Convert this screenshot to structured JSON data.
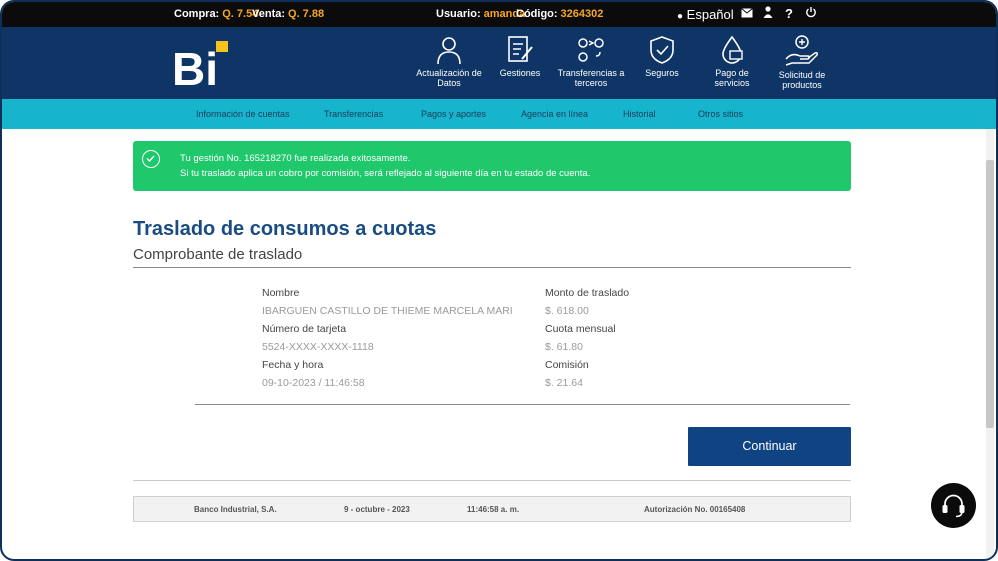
{
  "topbar": {
    "compra_label": "Compra:",
    "compra_value": "Q. 7.54",
    "venta_label": "Venta:",
    "venta_value": "Q. 7.88",
    "usuario_label": "Usuario:",
    "usuario_value": "amanda",
    "codigo_label": "Código:",
    "codigo_value": "3264302",
    "language": "Español"
  },
  "logo": "Bi",
  "nav": [
    {
      "label1": "Actualización de",
      "label2": "Datos",
      "icon": "user-icon"
    },
    {
      "label1": "Gestiones",
      "label2": "",
      "icon": "document-edit-icon"
    },
    {
      "label1": "Transferencias a",
      "label2": "terceros",
      "icon": "transfer-icon"
    },
    {
      "label1": "Seguros",
      "label2": "",
      "icon": "shield-check-icon"
    },
    {
      "label1": "Pago de",
      "label2": "servicios",
      "icon": "drop-card-icon"
    },
    {
      "label1": "Solicitud de",
      "label2": "productos",
      "icon": "hand-plus-icon"
    }
  ],
  "menu": [
    "Información de cuentas",
    "Transferencias",
    "Pagos y aportes",
    "Agencia en línea",
    "Historial",
    "Otros sitios"
  ],
  "alert": {
    "line1": "Tu gestión No. 165218270 fue realizada exitosamente.",
    "line2": "Si tu traslado aplica un cobro por comisión, será reflejado al siguiente día en tu estado de cuenta."
  },
  "page": {
    "title": "Traslado de consumos a cuotas",
    "subtitle": "Comprobante de traslado"
  },
  "details": {
    "nombre_label": "Nombre",
    "nombre_value": "IBARGUEN CASTILLO DE THIEME MARCELA MARI",
    "tarjeta_label": "Número de tarjeta",
    "tarjeta_value": "5524-XXXX-XXXX-1118",
    "fecha_label": "Fecha y hora",
    "fecha_value": "09-10-2023 / 11:46:58",
    "monto_label": "Monto de traslado",
    "monto_value": "$. 618.00",
    "cuota_label": "Cuota mensual",
    "cuota_value": "$. 61.80",
    "comision_label": "Comisión",
    "comision_value": "$. 21.64"
  },
  "continue_label": "Continuar",
  "footer": {
    "bank": "Banco Industrial, S.A.",
    "date": "9 - octubre - 2023",
    "time": "11:46:58 a. m.",
    "auth": "Autorización No. 00165408"
  },
  "colors": {
    "header": "#0e3565",
    "menu": "#16b5cd",
    "success": "#20c86c",
    "primary_button": "#0f4382",
    "accent": "#f6a623"
  }
}
